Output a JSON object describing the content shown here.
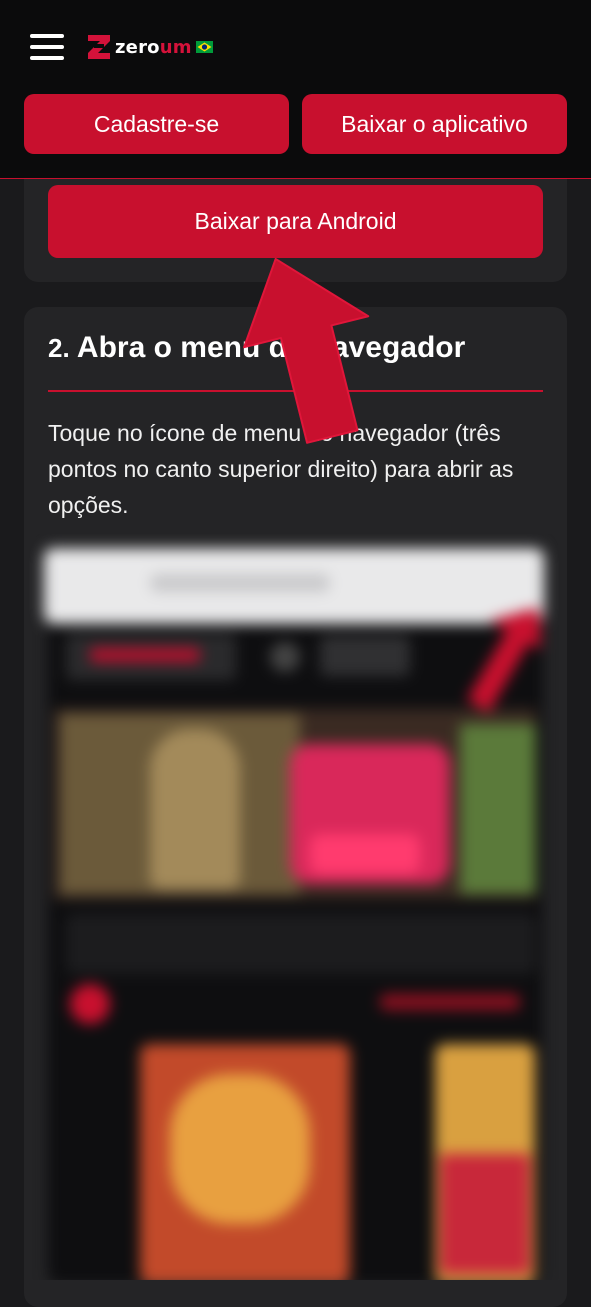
{
  "header": {
    "logo": {
      "zero": "zero",
      "um": "um",
      "flag": "brazil-flag"
    },
    "menu_icon": "hamburger-menu-icon",
    "buttons": {
      "signup": "Cadastre-se",
      "download_app": "Baixar o aplicativo"
    }
  },
  "download_card": {
    "android_button": "Baixar para Android"
  },
  "step": {
    "number": "2.",
    "title": "Abra o menu do navegador",
    "description": "Toque no ícone de menu do navegador (três pontos no canto superior direito) para abrir as opções."
  },
  "colors": {
    "accent": "#c8102e",
    "background": "#1a1a1c",
    "card": "#242426",
    "header": "#0b0b0c"
  }
}
